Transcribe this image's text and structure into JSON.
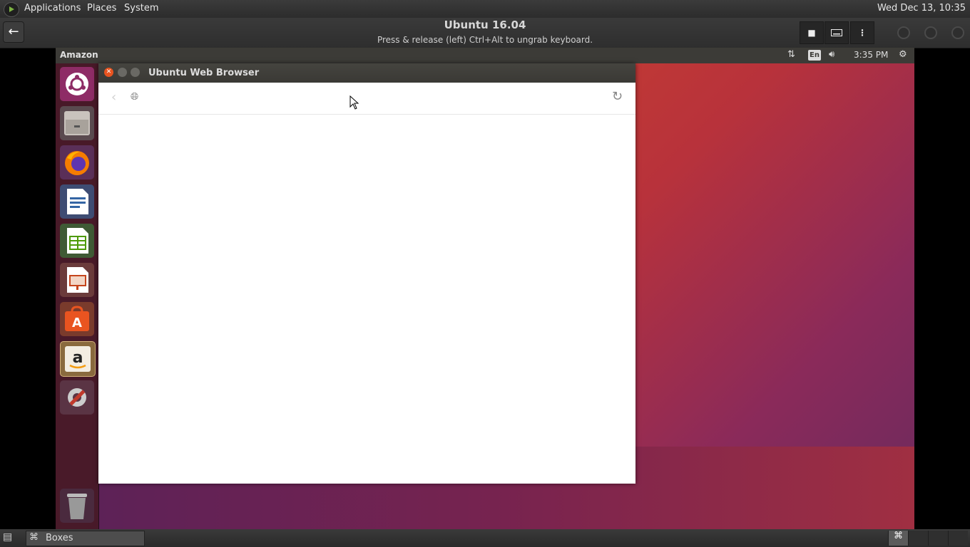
{
  "host_panel": {
    "menus": [
      "Applications",
      "Places",
      "System"
    ],
    "clock": "Wed Dec 13, 10:35"
  },
  "boxes_header": {
    "title": "Ubuntu 16.04",
    "subtitle": "Press & release (left) Ctrl+Alt to ungrab keyboard.",
    "back_icon": "back-arrow-icon",
    "buttons": [
      "stop-icon",
      "keyboard-icon",
      "more-options-icon"
    ]
  },
  "guest": {
    "panel": {
      "app_name": "Amazon",
      "keyboard_layout": "En",
      "time": "3:35 PM"
    },
    "launcher": [
      "ubuntu-dash-icon",
      "files-icon",
      "firefox-icon",
      "libreoffice-writer-icon",
      "libreoffice-calc-icon",
      "libreoffice-impress-icon",
      "software-center-icon",
      "amazon-icon",
      "system-settings-icon",
      "trash-icon"
    ],
    "browser": {
      "title": "Ubuntu Web Browser",
      "url": ""
    }
  },
  "bottom_panel": {
    "task_label": "Boxes"
  },
  "colors": {
    "accent": "#e95420",
    "panel": "#3c3b37",
    "host_panel": "#2e2e2e"
  }
}
